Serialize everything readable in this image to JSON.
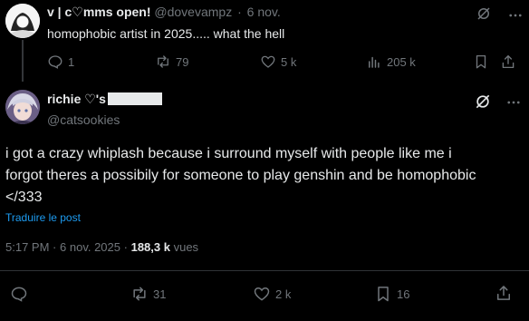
{
  "reply": {
    "name": "v | c♡mms open!",
    "handle": "@dovevampz",
    "separator": "·",
    "date": "6 nov.",
    "text": "homophobic artist in 2025..... what the hell",
    "stats": {
      "replies": "1",
      "reposts": "79",
      "likes": "5 k",
      "views": "205 k"
    }
  },
  "main": {
    "name": "richie ♡'s",
    "handle": "@catsookies",
    "text_lines": [
      "i got a crazy whiplash because i surround myself with people like me i",
      "forgot theres a possibily for someone to play genshin and be homophobic",
      "</333"
    ],
    "translate_label": "Traduire le post",
    "time": "5:17 PM",
    "separator": "·",
    "date": "6 nov. 2025",
    "views_count": "188,3 k",
    "views_label": "vues",
    "stats": {
      "reposts": "31",
      "likes": "2 k",
      "bookmarks": "16"
    }
  },
  "colors": {
    "background": "#000000",
    "text": "#e7e9ea",
    "muted": "#71767b",
    "link": "#1d9bf0"
  }
}
